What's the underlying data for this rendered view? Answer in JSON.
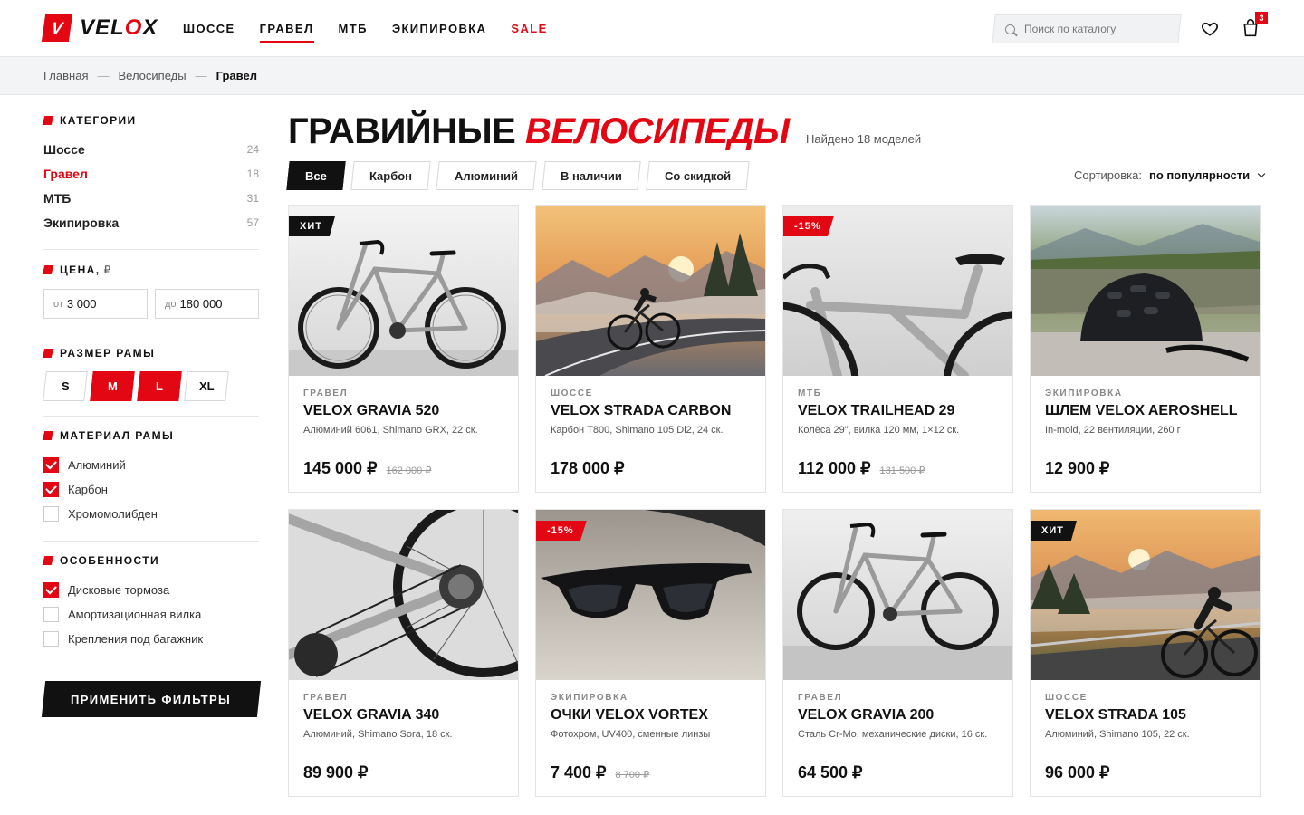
{
  "brand": {
    "logo_letter": "V",
    "name_part1": "VEL",
    "name_x": "O",
    "name_part2": "X"
  },
  "nav": [
    {
      "label": "ШОССЕ"
    },
    {
      "label": "ГРАВЕЛ",
      "active": true
    },
    {
      "label": "МТБ"
    },
    {
      "label": "ЭКИПИРОВКА"
    },
    {
      "label": "SALE"
    }
  ],
  "search": {
    "placeholder": "Поиск по каталогу",
    "icon": "search-icon"
  },
  "header_icons": {
    "wishlist": "heart-icon",
    "cart": "bag-icon",
    "cart_count": "3"
  },
  "breadcrumb": {
    "items": [
      "Главная",
      "Велосипеды"
    ],
    "current": "Гравел",
    "separator": "—"
  },
  "sidebar": {
    "categories": {
      "title": "КАТЕГОРИИ",
      "items": [
        {
          "label": "Шоссе",
          "count": "24"
        },
        {
          "label": "Гравел",
          "count": "18",
          "active": true
        },
        {
          "label": "МТБ",
          "count": "31"
        },
        {
          "label": "Экипировка",
          "count": "57"
        }
      ]
    },
    "price": {
      "title": "ЦЕНА,",
      "unit": "₽",
      "from_prefix": "от",
      "from_value": "3 000",
      "to_prefix": "до",
      "to_value": "180 000"
    },
    "frame_size": {
      "title": "РАЗМЕР РАМЫ",
      "options": [
        "S",
        "M",
        "L",
        "XL"
      ],
      "selected": [
        "M",
        "L"
      ]
    },
    "material": {
      "title": "МАТЕРИАЛ РАМЫ",
      "items": [
        {
          "label": "Алюминий",
          "checked": true
        },
        {
          "label": "Карбон",
          "checked": true
        },
        {
          "label": "Хромомолибден",
          "checked": false
        }
      ]
    },
    "features": {
      "title": "ОСОБЕННОСТИ",
      "items": [
        {
          "label": "Дисковые тормоза",
          "checked": true
        },
        {
          "label": "Амортизационная вилка",
          "checked": false
        },
        {
          "label": "Крепления под багажник",
          "checked": false
        }
      ]
    },
    "apply_label": "ПРИМЕНИТЬ ФИЛЬТРЫ"
  },
  "main": {
    "title_part1": "ГРАВИЙНЫЕ",
    "title_part2": "ВЕЛОСИПЕДЫ",
    "found": "Найдено 18 моделей",
    "chips": [
      "Все",
      "Карбон",
      "Алюминий",
      "В наличии",
      "Со скидкой"
    ],
    "active_chip": "Все",
    "sort_label": "Сортировка:",
    "sort_value": "по популярности"
  },
  "products": [
    {
      "category": "ГРАВЕЛ",
      "name": "VELOX GRAVIA 520",
      "spec": "Алюминий 6061, Shimano GRX, 22 ск.",
      "price": "145 000 ₽",
      "old_price": "162 000 ₽",
      "badge": "ХИТ",
      "badge_type": "hit",
      "image": "gravel-bike-side"
    },
    {
      "category": "ШОССЕ",
      "name": "VELOX STRADA CARBON",
      "spec": "Карбон T800, Shimano 105 Di2, 24 ск.",
      "price": "178 000 ₽",
      "old_price": "",
      "badge": "",
      "badge_type": "",
      "image": "road-cyclist-sunset"
    },
    {
      "category": "МТБ",
      "name": "VELOX TRAILHEAD 29",
      "spec": "Колёса 29\", вилка 120 мм, 1×12 ск.",
      "price": "112 000 ₽",
      "old_price": "131 500 ₽",
      "badge": "-15%",
      "badge_type": "sale",
      "image": "bike-frame-closeup"
    },
    {
      "category": "ЭКИПИРОВКА",
      "name": "ШЛЕМ VELOX AEROSHELL",
      "spec": "In-mold, 22 вентиляции, 260 г",
      "price": "12 900 ₽",
      "old_price": "",
      "badge": "",
      "badge_type": "",
      "image": "helmet-mountains"
    },
    {
      "category": "ГРАВЕЛ",
      "name": "VELOX GRAVIA 340",
      "spec": "Алюминий, Shimano Sora, 18 ск.",
      "price": "89 900 ₽",
      "old_price": "",
      "badge": "",
      "badge_type": "",
      "image": "rear-wheel-drivetrain"
    },
    {
      "category": "ЭКИПИРОВКА",
      "name": "ОЧКИ VELOX VORTEX",
      "spec": "Фотохром, UV400, сменные линзы",
      "price": "7 400 ₽",
      "old_price": "8 700 ₽",
      "badge": "-15%",
      "badge_type": "sale",
      "image": "sunglasses-asphalt"
    },
    {
      "category": "ГРАВЕЛ",
      "name": "VELOX GRAVIA 200",
      "spec": "Сталь Cr-Mo, механические диски, 16 ск.",
      "price": "64 500 ₽",
      "old_price": "",
      "badge": "",
      "badge_type": "",
      "image": "gravel-bike-studio"
    },
    {
      "category": "ШОССЕ",
      "name": "VELOX STRADA 105",
      "spec": "Алюминий, Shimano 105, 22 ск.",
      "price": "96 000 ₽",
      "old_price": "",
      "badge": "ХИТ",
      "badge_type": "hit",
      "image": "cyclist-mountain-sunrise"
    }
  ]
}
